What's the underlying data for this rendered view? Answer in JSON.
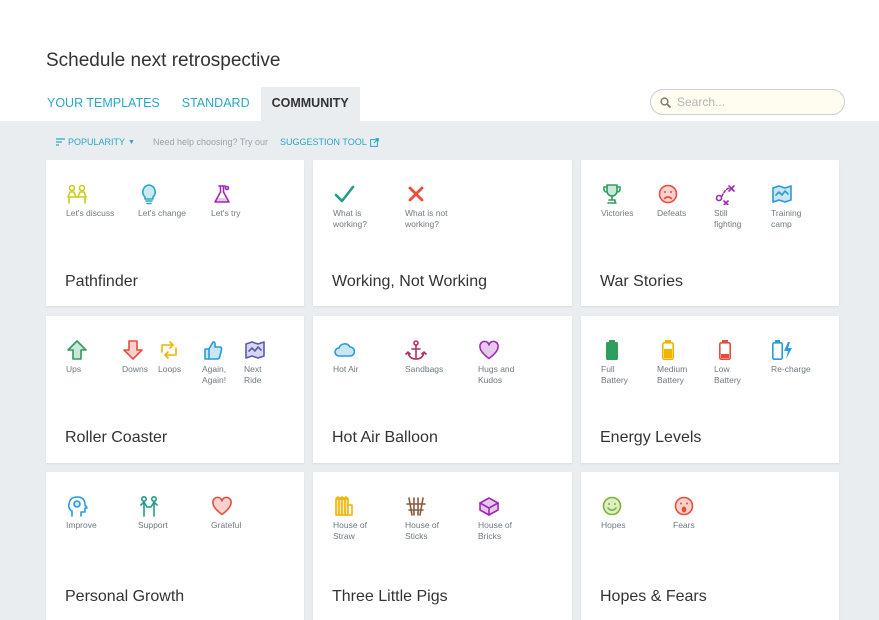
{
  "page": {
    "title": "Schedule next retrospective"
  },
  "tabs": [
    {
      "label": "YOUR TEMPLATES",
      "active": false
    },
    {
      "label": "STANDARD",
      "active": false
    },
    {
      "label": "COMMUNITY",
      "active": true
    }
  ],
  "search": {
    "placeholder": "Search..."
  },
  "toolbar": {
    "sort_label": "POPULARITY",
    "help_text": "Need help choosing? Try our",
    "suggestion_label": "SUGGESTION TOOL"
  },
  "templates": [
    {
      "name": "Pathfinder",
      "items": [
        {
          "label": "Let's discuss",
          "icon": "discuss-icon",
          "color": "#c8cc1e"
        },
        {
          "label": "Let's change",
          "icon": "lightbulb-icon",
          "color": "#2aa7c2"
        },
        {
          "label": "Let's try",
          "icon": "flask-icon",
          "color": "#9b2bb5"
        }
      ]
    },
    {
      "name": "Working, Not Working",
      "items": [
        {
          "label": "What is\nworking?",
          "icon": "check-icon",
          "color": "#1f9e89"
        },
        {
          "label": "What is not\nworking?",
          "icon": "x-icon",
          "color": "#e84c3d"
        }
      ]
    },
    {
      "name": "War Stories",
      "items": [
        {
          "label": "Victories",
          "icon": "trophy-icon",
          "color": "#2d9e5e"
        },
        {
          "label": "Defeats",
          "icon": "sad-face-icon",
          "color": "#e84c3d"
        },
        {
          "label": "Still\nfighting",
          "icon": "strategy-icon",
          "color": "#9b2bb5"
        },
        {
          "label": "Training\ncamp",
          "icon": "map-icon",
          "color": "#2a9bd6"
        }
      ]
    },
    {
      "name": "Roller Coaster",
      "items": [
        {
          "label": "Ups",
          "icon": "arrow-up-icon",
          "color": "#2d9e5e"
        },
        {
          "label": "Downs",
          "icon": "arrow-down-icon",
          "color": "#e84c3d"
        },
        {
          "label": "Loops",
          "icon": "loop-icon",
          "color": "#f0b400"
        },
        {
          "label": "Again,\nAgain!",
          "icon": "thumbs-up-icon",
          "color": "#2a9bd6"
        },
        {
          "label": "Next\nRide",
          "icon": "map-icon",
          "color": "#5b5bb5"
        }
      ]
    },
    {
      "name": "Hot Air Balloon",
      "items": [
        {
          "label": "Hot Air",
          "icon": "cloud-icon",
          "color": "#2a9bd6"
        },
        {
          "label": "Sandbags",
          "icon": "anchor-icon",
          "color": "#b5306b"
        },
        {
          "label": "Hugs and\nKudos",
          "icon": "heart-icon",
          "color": "#9b2bb5"
        }
      ]
    },
    {
      "name": "Energy Levels",
      "items": [
        {
          "label": "Full\nBattery",
          "icon": "battery-full-icon",
          "color": "#2d9e5e"
        },
        {
          "label": "Medium\nBattery",
          "icon": "battery-medium-icon",
          "color": "#f0b400"
        },
        {
          "label": "Low\nBattery",
          "icon": "battery-low-icon",
          "color": "#e84c3d"
        },
        {
          "label": "Re-charge",
          "icon": "battery-charge-icon",
          "color": "#2a9bd6"
        }
      ]
    },
    {
      "name": "Personal Growth",
      "items": [
        {
          "label": "Improve",
          "icon": "head-bulb-icon",
          "color": "#2a9bd6"
        },
        {
          "label": "Support",
          "icon": "people-icon",
          "color": "#1f9e89"
        },
        {
          "label": "Grateful",
          "icon": "heart-icon",
          "color": "#e84c3d"
        }
      ]
    },
    {
      "name": "Three Little Pigs",
      "items": [
        {
          "label": "House of\nStraw",
          "icon": "straw-icon",
          "color": "#f0b400"
        },
        {
          "label": "House of\nSticks",
          "icon": "sticks-icon",
          "color": "#8a5a3c"
        },
        {
          "label": "House of\nBricks",
          "icon": "brick-icon",
          "color": "#9b2bb5"
        }
      ]
    },
    {
      "name": "Hopes & Fears",
      "items": [
        {
          "label": "Hopes",
          "icon": "smile-icon",
          "color": "#7ab52d"
        },
        {
          "label": "Fears",
          "icon": "scared-face-icon",
          "color": "#e84c3d"
        }
      ]
    }
  ]
}
